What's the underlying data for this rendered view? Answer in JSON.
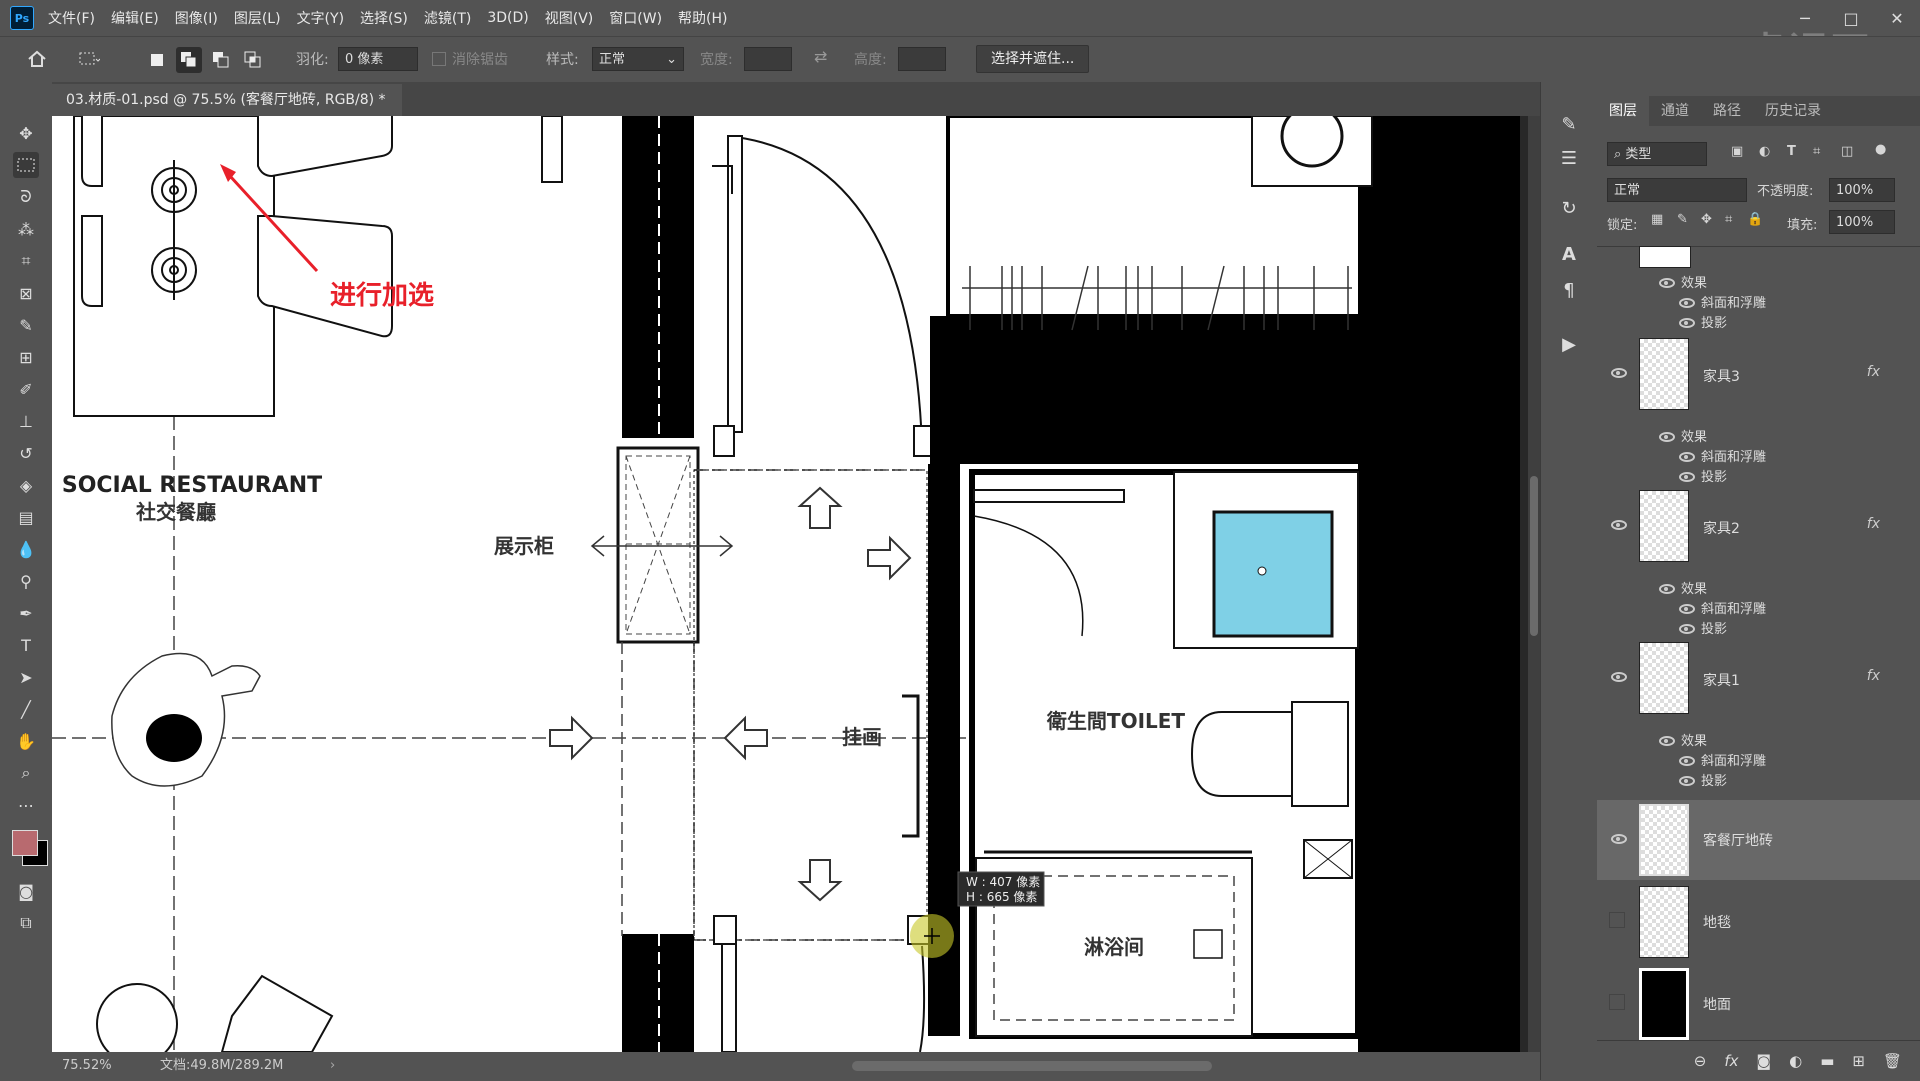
{
  "app": {
    "logo": "Ps",
    "menu": [
      "文件(F)",
      "编辑(E)",
      "图像(I)",
      "图层(L)",
      "文字(Y)",
      "选择(S)",
      "滤镜(T)",
      "3D(D)",
      "视图(V)",
      "窗口(W)",
      "帮助(H)"
    ],
    "watermark": "虎课网"
  },
  "options": {
    "feather_label": "羽化:",
    "feather_value": "0 像素",
    "antialias_label": "消除锯齿",
    "style_label": "样式:",
    "style_value": "正常",
    "width_label": "宽度:",
    "height_label": "高度:",
    "select_mask_button": "选择并遮住..."
  },
  "document": {
    "tab_title": "03.材质-01.psd @ 75.5% (客餐厅地砖, RGB/8) *",
    "zoom": "75.52%",
    "doc_size": "文档:49.8M/289.2M"
  },
  "annotation": {
    "text": "进行加选",
    "color": "#e8202a"
  },
  "selection_info": {
    "w": "W : 407 像素",
    "h": "H : 665 像素"
  },
  "floorplan": {
    "restaurant_en": "SOCIAL RESTAURANT",
    "restaurant_cn": "社交餐廳",
    "display_cabinet": "展示柜",
    "painting": "挂画",
    "toilet": "衛生間TOILET",
    "shower": "淋浴间"
  },
  "layers_panel": {
    "tabs": [
      "图层",
      "通道",
      "路径",
      "历史记录"
    ],
    "filter_kind": "类型",
    "blend_mode": "正常",
    "opacity_label": "不透明度:",
    "opacity_value": "100%",
    "lock_label": "锁定:",
    "fill_label": "填充:",
    "fill_value": "100%",
    "effects_label": "效果",
    "bevel_label": "斜面和浮雕",
    "shadow_label": "投影",
    "fx_label": "fx",
    "layers": [
      {
        "name": "家具3"
      },
      {
        "name": "家具2"
      },
      {
        "name": "家具1"
      },
      {
        "name": "客餐厅地砖"
      },
      {
        "name": "地毯"
      },
      {
        "name": "地面"
      }
    ]
  },
  "colors": {
    "foreground": "#b86a6f",
    "background": "#000000",
    "toilet_basin": "#7fd0e6"
  }
}
